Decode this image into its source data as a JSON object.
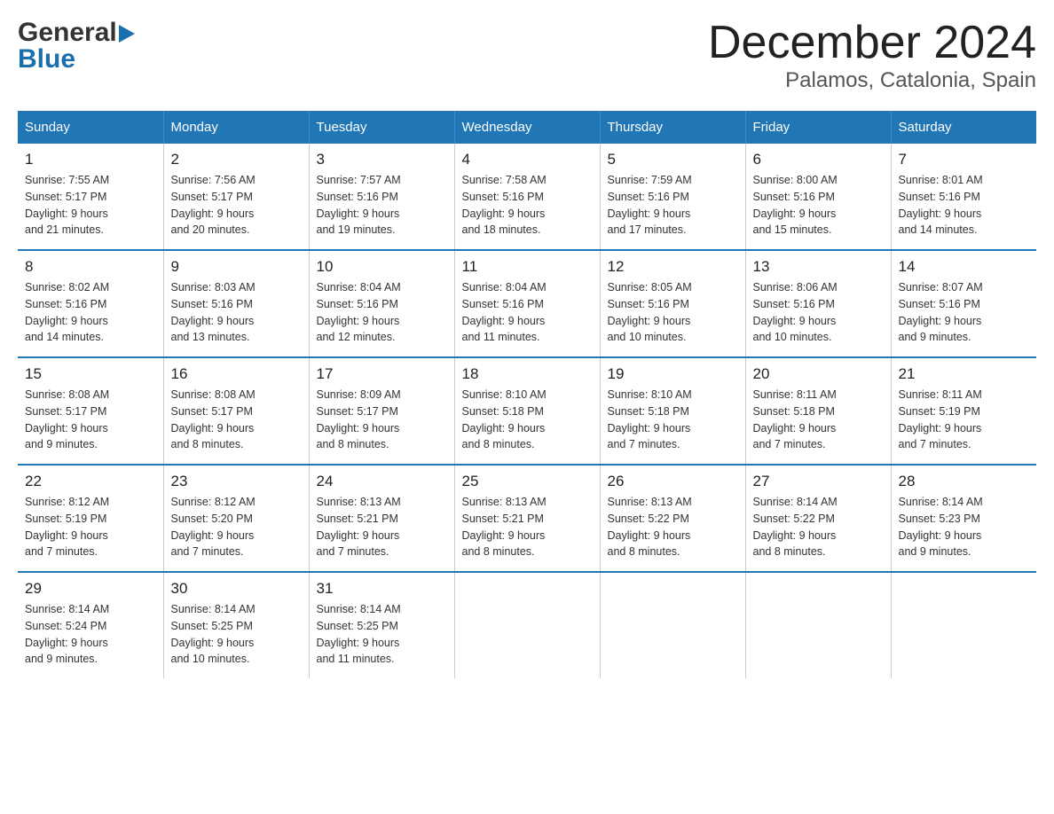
{
  "header": {
    "logo_general": "General",
    "logo_blue": "Blue",
    "title": "December 2024",
    "subtitle": "Palamos, Catalonia, Spain"
  },
  "weekdays": [
    "Sunday",
    "Monday",
    "Tuesday",
    "Wednesday",
    "Thursday",
    "Friday",
    "Saturday"
  ],
  "weeks": [
    [
      {
        "day": "1",
        "sunrise": "7:55 AM",
        "sunset": "5:17 PM",
        "daylight": "9 hours and 21 minutes."
      },
      {
        "day": "2",
        "sunrise": "7:56 AM",
        "sunset": "5:17 PM",
        "daylight": "9 hours and 20 minutes."
      },
      {
        "day": "3",
        "sunrise": "7:57 AM",
        "sunset": "5:16 PM",
        "daylight": "9 hours and 19 minutes."
      },
      {
        "day": "4",
        "sunrise": "7:58 AM",
        "sunset": "5:16 PM",
        "daylight": "9 hours and 18 minutes."
      },
      {
        "day": "5",
        "sunrise": "7:59 AM",
        "sunset": "5:16 PM",
        "daylight": "9 hours and 17 minutes."
      },
      {
        "day": "6",
        "sunrise": "8:00 AM",
        "sunset": "5:16 PM",
        "daylight": "9 hours and 15 minutes."
      },
      {
        "day": "7",
        "sunrise": "8:01 AM",
        "sunset": "5:16 PM",
        "daylight": "9 hours and 14 minutes."
      }
    ],
    [
      {
        "day": "8",
        "sunrise": "8:02 AM",
        "sunset": "5:16 PM",
        "daylight": "9 hours and 14 minutes."
      },
      {
        "day": "9",
        "sunrise": "8:03 AM",
        "sunset": "5:16 PM",
        "daylight": "9 hours and 13 minutes."
      },
      {
        "day": "10",
        "sunrise": "8:04 AM",
        "sunset": "5:16 PM",
        "daylight": "9 hours and 12 minutes."
      },
      {
        "day": "11",
        "sunrise": "8:04 AM",
        "sunset": "5:16 PM",
        "daylight": "9 hours and 11 minutes."
      },
      {
        "day": "12",
        "sunrise": "8:05 AM",
        "sunset": "5:16 PM",
        "daylight": "9 hours and 10 minutes."
      },
      {
        "day": "13",
        "sunrise": "8:06 AM",
        "sunset": "5:16 PM",
        "daylight": "9 hours and 10 minutes."
      },
      {
        "day": "14",
        "sunrise": "8:07 AM",
        "sunset": "5:16 PM",
        "daylight": "9 hours and 9 minutes."
      }
    ],
    [
      {
        "day": "15",
        "sunrise": "8:08 AM",
        "sunset": "5:17 PM",
        "daylight": "9 hours and 9 minutes."
      },
      {
        "day": "16",
        "sunrise": "8:08 AM",
        "sunset": "5:17 PM",
        "daylight": "9 hours and 8 minutes."
      },
      {
        "day": "17",
        "sunrise": "8:09 AM",
        "sunset": "5:17 PM",
        "daylight": "9 hours and 8 minutes."
      },
      {
        "day": "18",
        "sunrise": "8:10 AM",
        "sunset": "5:18 PM",
        "daylight": "9 hours and 8 minutes."
      },
      {
        "day": "19",
        "sunrise": "8:10 AM",
        "sunset": "5:18 PM",
        "daylight": "9 hours and 7 minutes."
      },
      {
        "day": "20",
        "sunrise": "8:11 AM",
        "sunset": "5:18 PM",
        "daylight": "9 hours and 7 minutes."
      },
      {
        "day": "21",
        "sunrise": "8:11 AM",
        "sunset": "5:19 PM",
        "daylight": "9 hours and 7 minutes."
      }
    ],
    [
      {
        "day": "22",
        "sunrise": "8:12 AM",
        "sunset": "5:19 PM",
        "daylight": "9 hours and 7 minutes."
      },
      {
        "day": "23",
        "sunrise": "8:12 AM",
        "sunset": "5:20 PM",
        "daylight": "9 hours and 7 minutes."
      },
      {
        "day": "24",
        "sunrise": "8:13 AM",
        "sunset": "5:21 PM",
        "daylight": "9 hours and 7 minutes."
      },
      {
        "day": "25",
        "sunrise": "8:13 AM",
        "sunset": "5:21 PM",
        "daylight": "9 hours and 8 minutes."
      },
      {
        "day": "26",
        "sunrise": "8:13 AM",
        "sunset": "5:22 PM",
        "daylight": "9 hours and 8 minutes."
      },
      {
        "day": "27",
        "sunrise": "8:14 AM",
        "sunset": "5:22 PM",
        "daylight": "9 hours and 8 minutes."
      },
      {
        "day": "28",
        "sunrise": "8:14 AM",
        "sunset": "5:23 PM",
        "daylight": "9 hours and 9 minutes."
      }
    ],
    [
      {
        "day": "29",
        "sunrise": "8:14 AM",
        "sunset": "5:24 PM",
        "daylight": "9 hours and 9 minutes."
      },
      {
        "day": "30",
        "sunrise": "8:14 AM",
        "sunset": "5:25 PM",
        "daylight": "9 hours and 10 minutes."
      },
      {
        "day": "31",
        "sunrise": "8:14 AM",
        "sunset": "5:25 PM",
        "daylight": "9 hours and 11 minutes."
      },
      null,
      null,
      null,
      null
    ]
  ],
  "labels": {
    "sunrise": "Sunrise:",
    "sunset": "Sunset:",
    "daylight": "Daylight:"
  },
  "colors": {
    "header_bg": "#2176b5",
    "border_blue": "#2176b5"
  }
}
